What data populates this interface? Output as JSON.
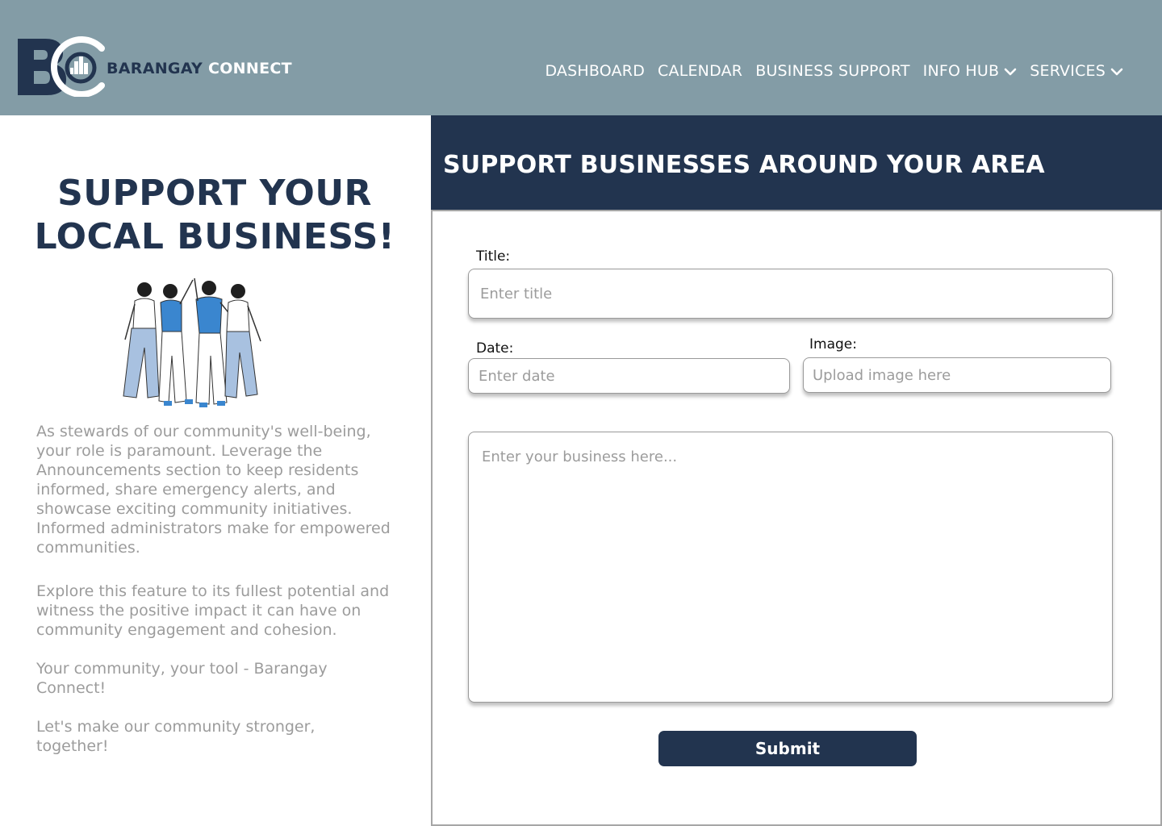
{
  "brand": {
    "name_part1": "BARANGAY",
    "name_part2": "CONNECT",
    "logo_icon": "bc-city-logo-icon",
    "colors": {
      "navy": "#22344f",
      "header": "#839ca6",
      "muted_text": "#9c9c9c"
    }
  },
  "nav": {
    "items": [
      {
        "label": "DASHBOARD"
      },
      {
        "label": "CALENDAR"
      },
      {
        "label": "BUSINESS SUPPORT"
      },
      {
        "label": "INFO HUB",
        "icon": "chevron-down-icon"
      },
      {
        "label": "SERVICES",
        "icon": "chevron-down-icon"
      }
    ]
  },
  "left": {
    "title_line1": "SUPPORT YOUR",
    "title_line2": "LOCAL BUSINESS!",
    "illustration": "people-high-five-illustration",
    "paragraphs": [
      "As stewards of our community's well-being, your role is paramount. Leverage the Announcements section to keep residents informed, share emergency alerts, and showcase exciting community initiatives. Informed administrators make for empowered communities.",
      "Explore this feature to its fullest potential and witness the positive impact it can have on community engagement and cohesion.",
      "Your community, your tool - Barangay Connect!",
      "Let's make our community stronger, together!"
    ]
  },
  "form": {
    "heading": "SUPPORT BUSINESSES AROUND YOUR AREA",
    "title_label": "Title:",
    "title_placeholder": "Enter title",
    "date_label": "Date:",
    "date_placeholder": "Enter date",
    "image_label": "Image:",
    "image_placeholder": "Upload image here",
    "body_placeholder": "Enter your business here...",
    "submit_label": "Submit"
  }
}
